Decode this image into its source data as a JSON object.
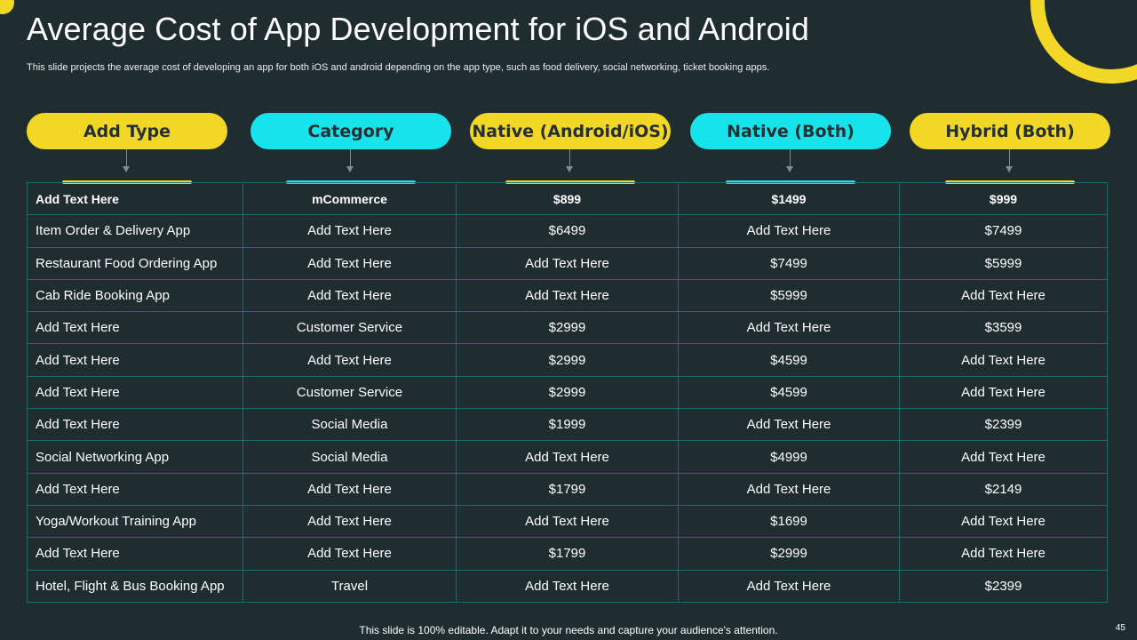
{
  "title": "Average Cost of App Development for iOS and Android",
  "subtitle": "This slide projects the average cost of  developing an app for both iOS and android depending on the app type,  such as food delivery,  social networking, ticket booking apps.",
  "headers": [
    {
      "label": "Add Type",
      "color": "yellow"
    },
    {
      "label": "Category",
      "color": "cyan"
    },
    {
      "label": "Native (Android/iOS)",
      "color": "yellow"
    },
    {
      "label": "Native (Both)",
      "color": "cyan"
    },
    {
      "label": "Hybrid (Both)",
      "color": "yellow"
    }
  ],
  "colors": {
    "yellow": "#f2d726",
    "cyan": "#17e3ea",
    "background": "#1f2d31",
    "grid": "#1d6c6e"
  },
  "rows": [
    [
      "Add Text Here",
      "mCommerce",
      "$899",
      "$1499",
      "$999"
    ],
    [
      "Item Order & Delivery App",
      "Add Text Here",
      "$6499",
      "Add Text Here",
      "$7499"
    ],
    [
      "Restaurant Food Ordering App",
      "Add Text Here",
      "Add Text Here",
      "$7499",
      "$5999"
    ],
    [
      "Cab Ride Booking App",
      "Add Text Here",
      "Add Text Here",
      "$5999",
      "Add Text Here"
    ],
    [
      "Add Text Here",
      "Customer Service",
      "$2999",
      "Add Text Here",
      "$3599"
    ],
    [
      "Add Text Here",
      "Add Text Here",
      "$2999",
      "$4599",
      "Add Text Here"
    ],
    [
      "Add Text Here",
      "Customer Service",
      "$2999",
      "$4599",
      "Add Text Here"
    ],
    [
      "Add Text Here",
      "Social Media",
      "$1999",
      "Add Text Here",
      "$2399"
    ],
    [
      "Social Networking App",
      "Social Media",
      "Add Text Here",
      "$4999",
      "Add Text Here"
    ],
    [
      "Add Text Here",
      "Add Text Here",
      "$1799",
      "Add Text Here",
      "$2149"
    ],
    [
      "Yoga/Workout Training App",
      "Add Text Here",
      "Add Text Here",
      "$1699",
      "Add Text Here"
    ],
    [
      "Add Text Here",
      "Add Text Here",
      "$1799",
      "$2999",
      "Add Text Here"
    ],
    [
      "Hotel, Flight & Bus Booking App",
      "Travel",
      "Add Text Here",
      "Add Text Here",
      "$2399"
    ]
  ],
  "footer": "This slide is 100% editable. Adapt it to your needs and capture your audience's attention.",
  "page_number": "45"
}
